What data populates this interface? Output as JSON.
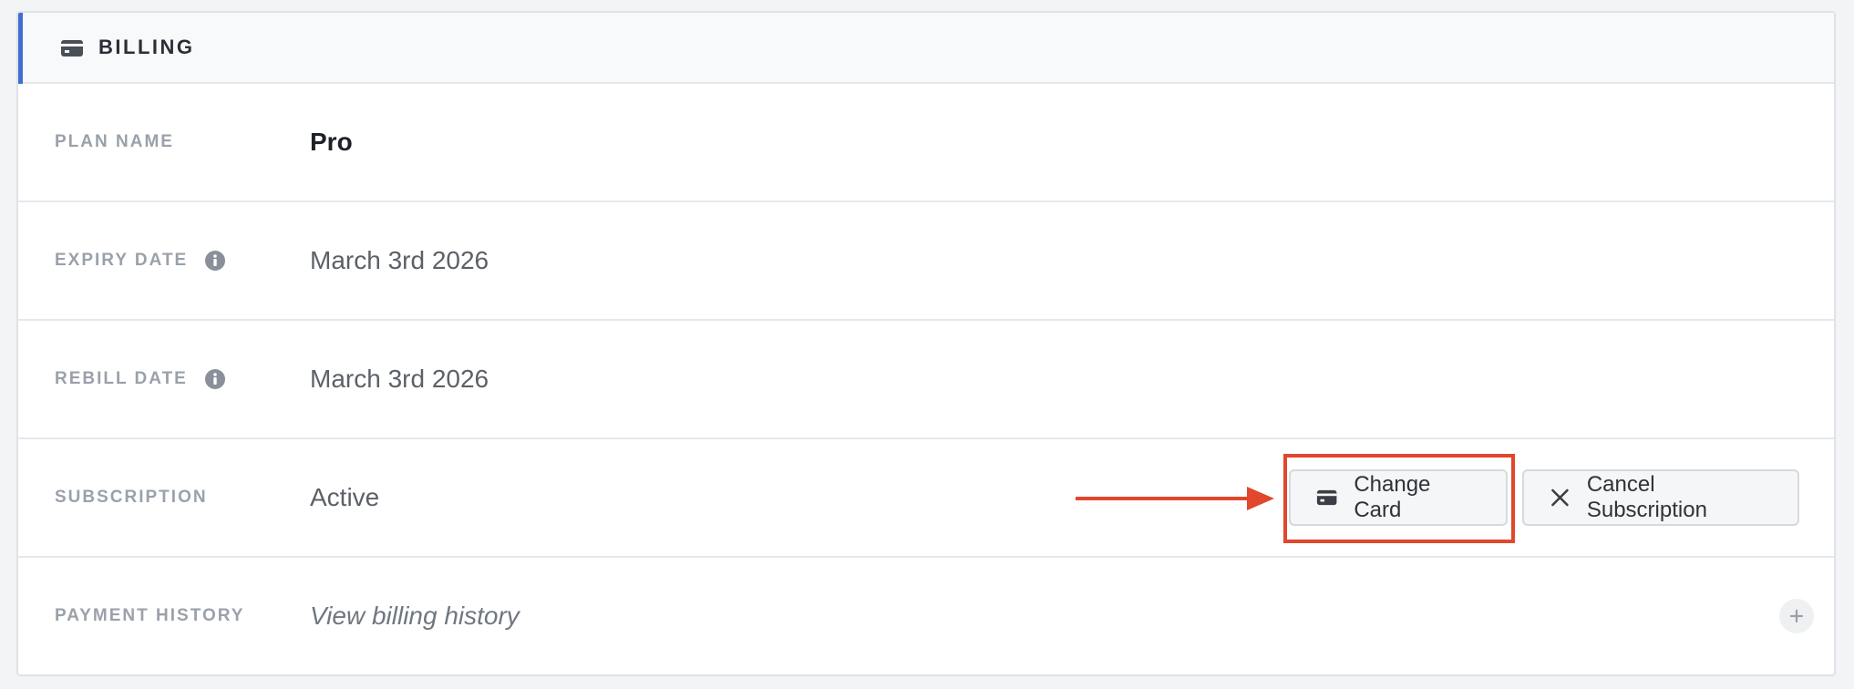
{
  "section": {
    "title": "BILLING",
    "icon": "credit-card-icon",
    "accent_color": "#3f6fd1"
  },
  "rows": {
    "plan": {
      "label": "PLAN NAME",
      "value": "Pro"
    },
    "expiry": {
      "label": "EXPIRY DATE",
      "value": "March 3rd 2026",
      "icon": "info-icon"
    },
    "rebill": {
      "label": "REBILL DATE",
      "value": "March 3rd 2026",
      "icon": "info-icon"
    },
    "subscription": {
      "label": "SUBSCRIPTION",
      "value": "Active",
      "change_card_label": "Change Card",
      "change_card_icon": "credit-card-icon",
      "cancel_label": "Cancel Subscription",
      "cancel_icon": "close-icon"
    },
    "payment_history": {
      "label": "PAYMENT HISTORY",
      "value": "View billing history",
      "expand_icon": "plus-icon"
    }
  },
  "annotation": {
    "highlight_color": "#e0472c",
    "target": "Change Card"
  }
}
